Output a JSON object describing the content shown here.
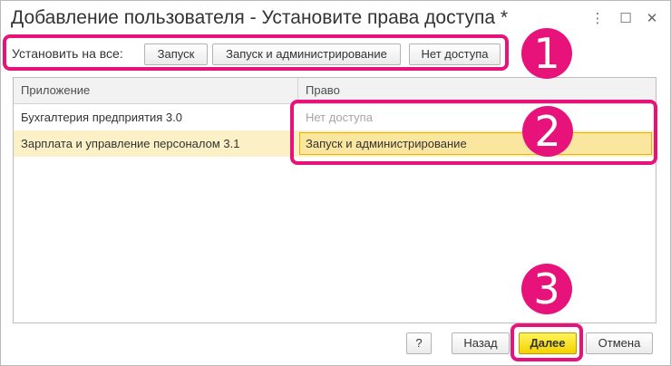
{
  "window": {
    "title": "Добавление пользователя - Установите права доступа *",
    "controls": {
      "more_icon": "⋮",
      "maximize_icon": "☐",
      "close_icon": "✕"
    }
  },
  "toolbar": {
    "label": "Установить на все:",
    "buttons": [
      "Запуск",
      "Запуск и администрирование",
      "Нет доступа"
    ]
  },
  "table": {
    "columns": [
      "Приложение",
      "Право"
    ],
    "rows": [
      {
        "app": "Бухгалтерия предприятия 3.0",
        "right": "Нет доступа",
        "selected": false
      },
      {
        "app": "Зарплата и управление персоналом 3.1",
        "right": "Запуск и администрирование",
        "selected": true
      }
    ]
  },
  "footer": {
    "help_label": "?",
    "back_label": "Назад",
    "next_label": "Далее",
    "cancel_label": "Отмена"
  },
  "annotations": [
    "1",
    "2",
    "3"
  ],
  "colors": {
    "highlight": "#e8137a",
    "primary": "#f3d200",
    "selected_row": "#fbf0c6"
  }
}
